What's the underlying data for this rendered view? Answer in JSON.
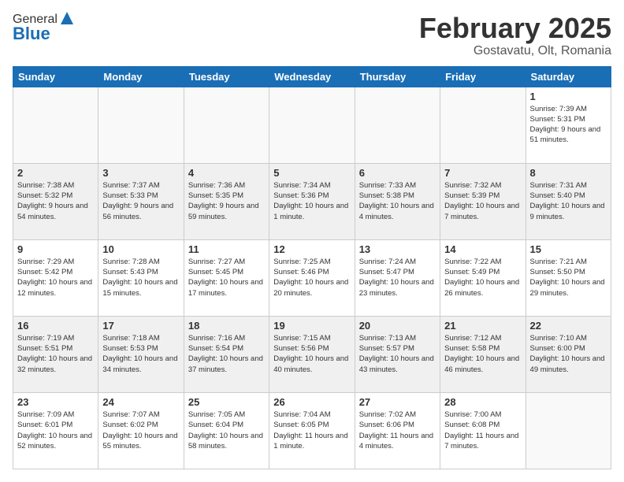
{
  "header": {
    "logo_general": "General",
    "logo_blue": "Blue",
    "month_title": "February 2025",
    "location": "Gostavatu, Olt, Romania"
  },
  "days_of_week": [
    "Sunday",
    "Monday",
    "Tuesday",
    "Wednesday",
    "Thursday",
    "Friday",
    "Saturday"
  ],
  "weeks": [
    [
      {
        "day": "",
        "info": ""
      },
      {
        "day": "",
        "info": ""
      },
      {
        "day": "",
        "info": ""
      },
      {
        "day": "",
        "info": ""
      },
      {
        "day": "",
        "info": ""
      },
      {
        "day": "",
        "info": ""
      },
      {
        "day": "1",
        "info": "Sunrise: 7:39 AM\nSunset: 5:31 PM\nDaylight: 9 hours and 51 minutes."
      }
    ],
    [
      {
        "day": "2",
        "info": "Sunrise: 7:38 AM\nSunset: 5:32 PM\nDaylight: 9 hours and 54 minutes."
      },
      {
        "day": "3",
        "info": "Sunrise: 7:37 AM\nSunset: 5:33 PM\nDaylight: 9 hours and 56 minutes."
      },
      {
        "day": "4",
        "info": "Sunrise: 7:36 AM\nSunset: 5:35 PM\nDaylight: 9 hours and 59 minutes."
      },
      {
        "day": "5",
        "info": "Sunrise: 7:34 AM\nSunset: 5:36 PM\nDaylight: 10 hours and 1 minute."
      },
      {
        "day": "6",
        "info": "Sunrise: 7:33 AM\nSunset: 5:38 PM\nDaylight: 10 hours and 4 minutes."
      },
      {
        "day": "7",
        "info": "Sunrise: 7:32 AM\nSunset: 5:39 PM\nDaylight: 10 hours and 7 minutes."
      },
      {
        "day": "8",
        "info": "Sunrise: 7:31 AM\nSunset: 5:40 PM\nDaylight: 10 hours and 9 minutes."
      }
    ],
    [
      {
        "day": "9",
        "info": "Sunrise: 7:29 AM\nSunset: 5:42 PM\nDaylight: 10 hours and 12 minutes."
      },
      {
        "day": "10",
        "info": "Sunrise: 7:28 AM\nSunset: 5:43 PM\nDaylight: 10 hours and 15 minutes."
      },
      {
        "day": "11",
        "info": "Sunrise: 7:27 AM\nSunset: 5:45 PM\nDaylight: 10 hours and 17 minutes."
      },
      {
        "day": "12",
        "info": "Sunrise: 7:25 AM\nSunset: 5:46 PM\nDaylight: 10 hours and 20 minutes."
      },
      {
        "day": "13",
        "info": "Sunrise: 7:24 AM\nSunset: 5:47 PM\nDaylight: 10 hours and 23 minutes."
      },
      {
        "day": "14",
        "info": "Sunrise: 7:22 AM\nSunset: 5:49 PM\nDaylight: 10 hours and 26 minutes."
      },
      {
        "day": "15",
        "info": "Sunrise: 7:21 AM\nSunset: 5:50 PM\nDaylight: 10 hours and 29 minutes."
      }
    ],
    [
      {
        "day": "16",
        "info": "Sunrise: 7:19 AM\nSunset: 5:51 PM\nDaylight: 10 hours and 32 minutes."
      },
      {
        "day": "17",
        "info": "Sunrise: 7:18 AM\nSunset: 5:53 PM\nDaylight: 10 hours and 34 minutes."
      },
      {
        "day": "18",
        "info": "Sunrise: 7:16 AM\nSunset: 5:54 PM\nDaylight: 10 hours and 37 minutes."
      },
      {
        "day": "19",
        "info": "Sunrise: 7:15 AM\nSunset: 5:56 PM\nDaylight: 10 hours and 40 minutes."
      },
      {
        "day": "20",
        "info": "Sunrise: 7:13 AM\nSunset: 5:57 PM\nDaylight: 10 hours and 43 minutes."
      },
      {
        "day": "21",
        "info": "Sunrise: 7:12 AM\nSunset: 5:58 PM\nDaylight: 10 hours and 46 minutes."
      },
      {
        "day": "22",
        "info": "Sunrise: 7:10 AM\nSunset: 6:00 PM\nDaylight: 10 hours and 49 minutes."
      }
    ],
    [
      {
        "day": "23",
        "info": "Sunrise: 7:09 AM\nSunset: 6:01 PM\nDaylight: 10 hours and 52 minutes."
      },
      {
        "day": "24",
        "info": "Sunrise: 7:07 AM\nSunset: 6:02 PM\nDaylight: 10 hours and 55 minutes."
      },
      {
        "day": "25",
        "info": "Sunrise: 7:05 AM\nSunset: 6:04 PM\nDaylight: 10 hours and 58 minutes."
      },
      {
        "day": "26",
        "info": "Sunrise: 7:04 AM\nSunset: 6:05 PM\nDaylight: 11 hours and 1 minute."
      },
      {
        "day": "27",
        "info": "Sunrise: 7:02 AM\nSunset: 6:06 PM\nDaylight: 11 hours and 4 minutes."
      },
      {
        "day": "28",
        "info": "Sunrise: 7:00 AM\nSunset: 6:08 PM\nDaylight: 11 hours and 7 minutes."
      },
      {
        "day": "",
        "info": ""
      }
    ]
  ]
}
